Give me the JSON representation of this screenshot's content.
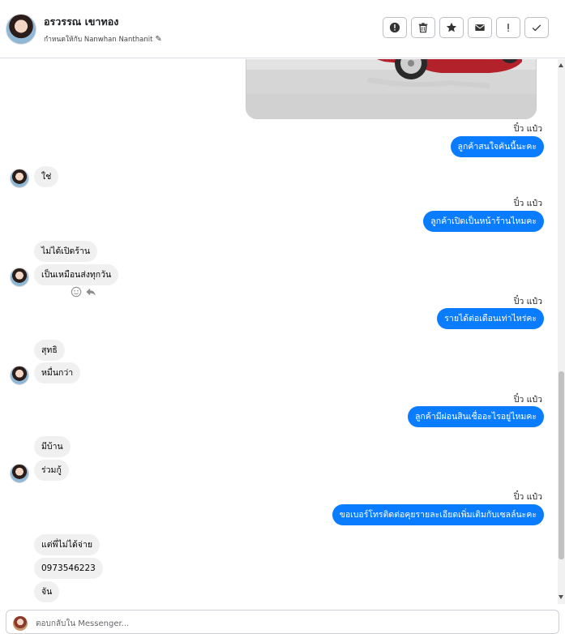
{
  "header": {
    "contact_name": "อรวรรณ เขาทอง",
    "assigned_text": "กำหนดให้กับ Nanwhan Nanthanit",
    "toolbar": [
      {
        "name": "report-spam-button",
        "icon": "alert-circle-icon"
      },
      {
        "name": "delete-button",
        "icon": "trash-icon"
      },
      {
        "name": "star-button",
        "icon": "star-icon"
      },
      {
        "name": "mark-unread-button",
        "icon": "envelope-icon"
      },
      {
        "name": "follow-up-button",
        "icon": "exclamation-icon"
      },
      {
        "name": "mark-done-button",
        "icon": "check-icon"
      }
    ]
  },
  "messages": [
    {
      "dir": "out",
      "sender": "ปิ๋ว แป๋ว",
      "text": "ลูกค้าสนใจคันนี้นะคะ"
    },
    {
      "dir": "in",
      "text": "ใช่"
    },
    {
      "dir": "out",
      "sender": "ปิ๋ว แป๋ว",
      "text": "ลูกค้าเปิดเป็นหน้าร้านไหมคะ"
    },
    {
      "dir": "in",
      "text": "ไม่ได้เปิดร้าน"
    },
    {
      "dir": "in",
      "text": "เป็นเหมือนส่งทุกวัน"
    },
    {
      "dir": "out",
      "sender": "ปิ๋ว แป๋ว",
      "text": "รายได้ต่อเดือนเท่าไหร่คะ"
    },
    {
      "dir": "in",
      "text": "สุทธิ"
    },
    {
      "dir": "in",
      "text": "หมื่นกว่า"
    },
    {
      "dir": "out",
      "sender": "ปิ๋ว แป๋ว",
      "text": "ลูกค้ามีผ่อนสินเชื่ออะไรอยู่ไหมคะ"
    },
    {
      "dir": "in",
      "text": "มีบ้าน"
    },
    {
      "dir": "in",
      "text": "ร่วมกู้"
    },
    {
      "dir": "out",
      "sender": "ปิ๋ว แป๋ว",
      "text": "ขอเบอร์โทรติดต่อคุยรายละเอียดเพิ่มเติมกับเซลล์นะคะ"
    },
    {
      "dir": "in",
      "text": "แต่พี่ไม่ได้จ่าย"
    },
    {
      "dir": "in",
      "text": "0973546223"
    },
    {
      "dir": "in",
      "text": "จัน"
    }
  ],
  "composer": {
    "placeholder": "ตอบกลับใน Messenger..."
  },
  "colors": {
    "outgoing_bubble": "#0a7cff",
    "incoming_bubble": "#f0f0f0"
  }
}
